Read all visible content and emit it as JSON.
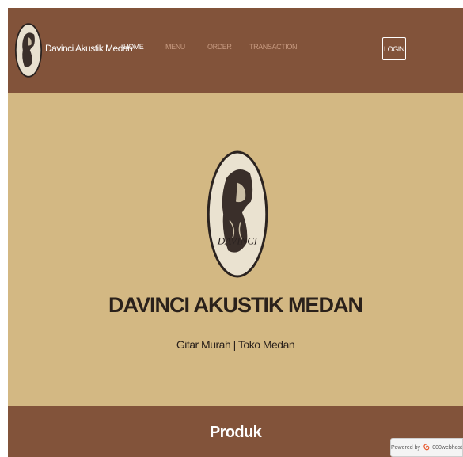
{
  "navbar": {
    "brand": "Davinci Akustik Medan",
    "links": [
      {
        "label": "HOME"
      },
      {
        "label": "MENU"
      },
      {
        "label": "ORDER"
      },
      {
        "label": "TRANSACTION"
      }
    ],
    "login_label": "LOGIN"
  },
  "hero": {
    "logo_text": "DAVINCI",
    "title": "DAVINCI AKUSTIK MEDAN",
    "subtitle": "Gitar Murah | Toko Medan"
  },
  "products": {
    "heading": "Produk"
  },
  "badge": {
    "powered_by": "Powered by",
    "host": "000webhost"
  },
  "colors": {
    "navbar_bg": "#82533a",
    "hero_bg": "#d3b883",
    "text_dark": "#2a211b",
    "nav_inactive": "#c79a80"
  }
}
